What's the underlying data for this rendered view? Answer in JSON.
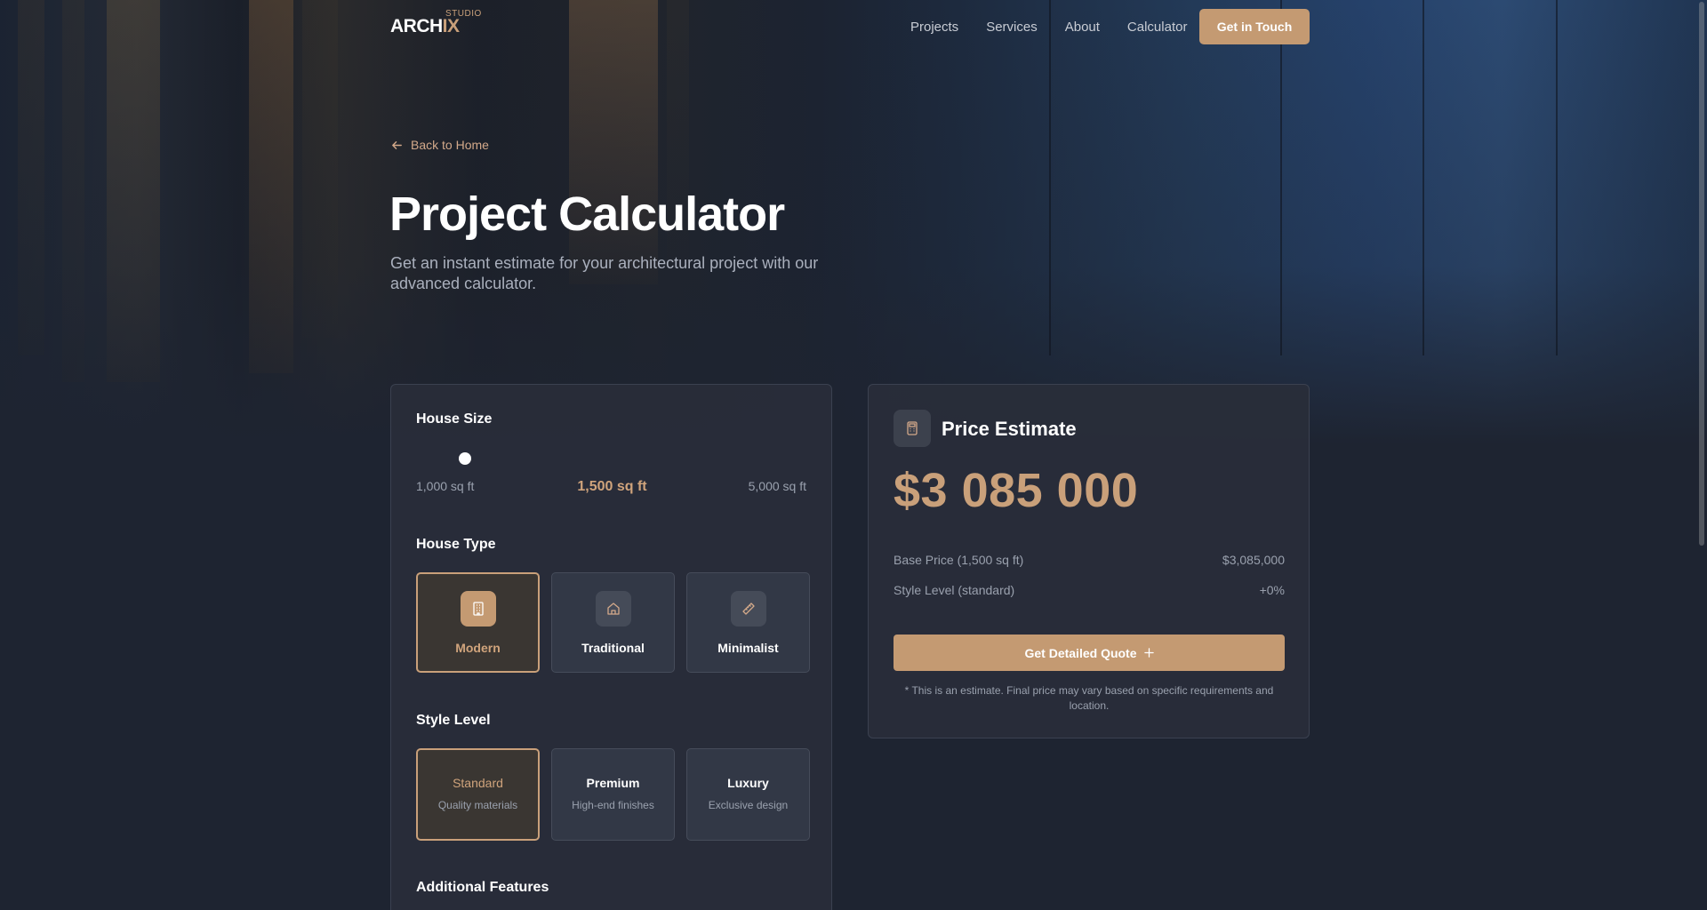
{
  "nav": {
    "logo_main": "ARCH",
    "logo_accent": "IX",
    "logo_super": "STUDIO",
    "links": [
      "Projects",
      "Services",
      "About",
      "Calculator"
    ],
    "cta": "Get in Touch"
  },
  "hero": {
    "back": "Back to Home",
    "title": "Project Calculator",
    "subtitle": "Get an instant estimate for your architectural project with our advanced calculator."
  },
  "calculator": {
    "house_size": {
      "label": "House Size",
      "min_label": "1,000 sq ft",
      "max_label": "5,000 sq ft",
      "value_label": "1,500 sq ft",
      "value_fraction": 0.125
    },
    "house_type": {
      "label": "House Type",
      "options": [
        {
          "label": "Modern",
          "icon": "building-icon",
          "selected": true
        },
        {
          "label": "Traditional",
          "icon": "house-icon",
          "selected": false
        },
        {
          "label": "Minimalist",
          "icon": "ruler-icon",
          "selected": false
        }
      ]
    },
    "style_level": {
      "label": "Style Level",
      "options": [
        {
          "label": "Standard",
          "sub": "Quality materials",
          "selected": true
        },
        {
          "label": "Premium",
          "sub": "High-end finishes",
          "selected": false
        },
        {
          "label": "Luxury",
          "sub": "Exclusive design",
          "selected": false
        }
      ]
    },
    "additional_features": {
      "label": "Additional Features"
    }
  },
  "estimate": {
    "title": "Price Estimate",
    "icon": "calculator-icon",
    "price": "$3 085 000",
    "rows": [
      {
        "label": "Base Price (1,500 sq ft)",
        "value": "$3,085,000"
      },
      {
        "label": "Style Level (standard)",
        "value": "+0%"
      }
    ],
    "button": "Get Detailed Quote",
    "note": "* This is an estimate. Final price may vary based on specific requirements and location."
  },
  "colors": {
    "accent": "#c49a72",
    "accent_text": "#d0a47c",
    "card_bg": "#292e3a",
    "page_bg": "#1e2431"
  }
}
